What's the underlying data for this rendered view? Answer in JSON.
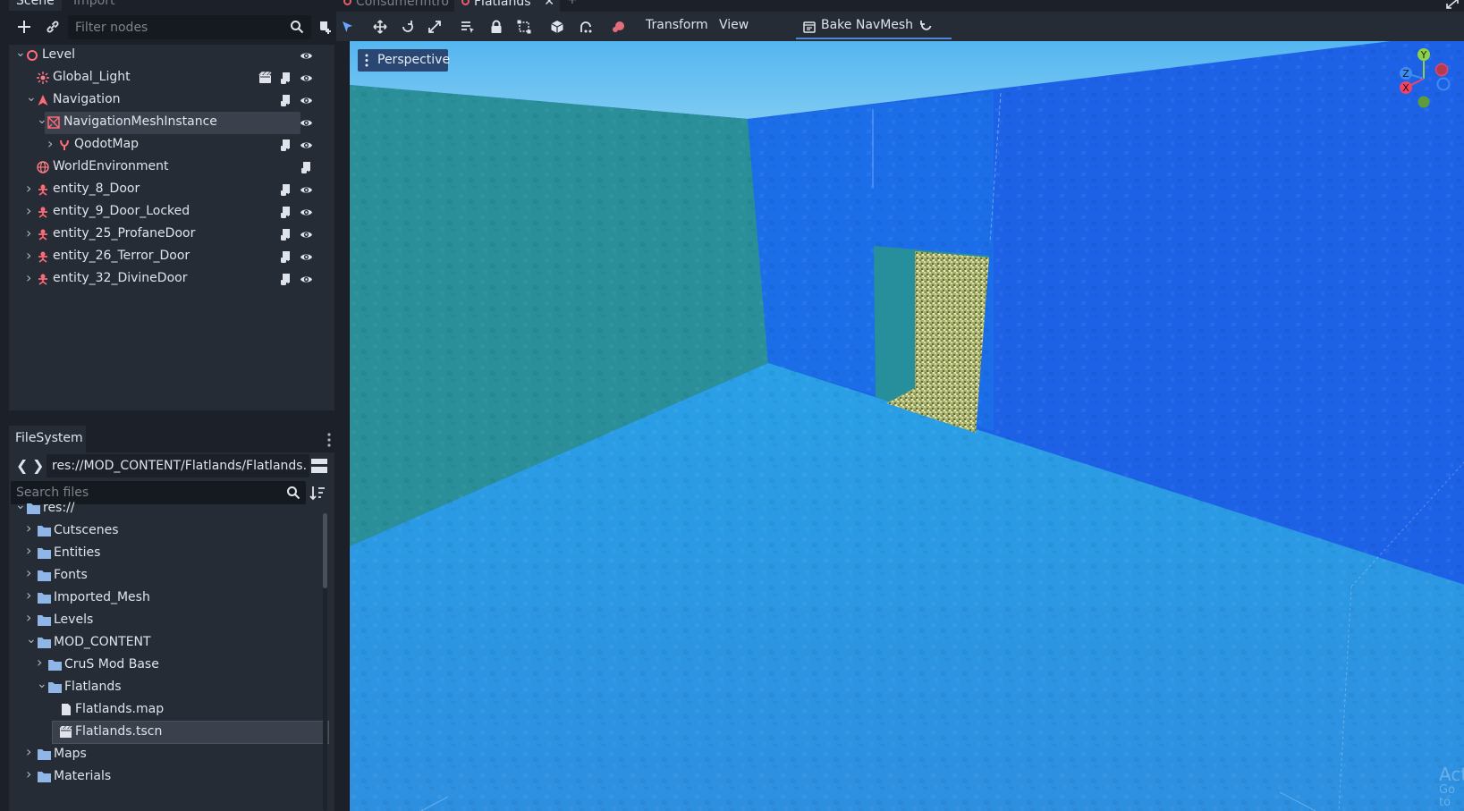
{
  "dock_tabs": {
    "scene": "Scene",
    "import": "Import"
  },
  "scene": {
    "filter_placeholder": "Filter nodes",
    "nodes": [
      {
        "label": "Level",
        "icon": "node3d-icon",
        "depth": 0,
        "expanded": true
      },
      {
        "label": "Global_Light",
        "icon": "light-icon",
        "depth": 1,
        "has_script": true,
        "has_scene": true
      },
      {
        "label": "Navigation",
        "icon": "navigation-icon",
        "depth": 1,
        "expanded": true,
        "has_script": true
      },
      {
        "label": "NavigationMeshInstance",
        "icon": "navmesh-icon",
        "depth": 2,
        "expanded": true,
        "selected": true
      },
      {
        "label": "QodotMap",
        "icon": "qodotmap-icon",
        "depth": 3,
        "has_script": true
      },
      {
        "label": "WorldEnvironment",
        "icon": "world-environment-icon",
        "depth": 1,
        "has_script": true
      },
      {
        "label": "entity_8_Door",
        "icon": "entity-icon",
        "depth": 1,
        "has_script": true
      },
      {
        "label": "entity_9_Door_Locked",
        "icon": "entity-icon",
        "depth": 1,
        "has_script": true
      },
      {
        "label": "entity_25_ProfaneDoor",
        "icon": "entity-icon",
        "depth": 1,
        "has_script": true
      },
      {
        "label": "entity_26_Terror_Door",
        "icon": "entity-icon",
        "depth": 1,
        "has_script": true
      },
      {
        "label": "entity_32_DivineDoor",
        "icon": "entity-icon",
        "depth": 1,
        "has_script": true
      }
    ]
  },
  "filesystem": {
    "tab_label": "FileSystem",
    "path": "res://MOD_CONTENT/Flatlands/Flatlands.",
    "search_placeholder": "Search files",
    "items": [
      {
        "label": "res://",
        "type": "folder",
        "depth": 0,
        "expanded": true
      },
      {
        "label": "Cutscenes",
        "type": "folder",
        "depth": 1
      },
      {
        "label": "Entities",
        "type": "folder",
        "depth": 1
      },
      {
        "label": "Fonts",
        "type": "folder",
        "depth": 1
      },
      {
        "label": "Imported_Mesh",
        "type": "folder",
        "depth": 1
      },
      {
        "label": "Levels",
        "type": "folder",
        "depth": 1
      },
      {
        "label": "MOD_CONTENT",
        "type": "folder",
        "depth": 1,
        "expanded": true
      },
      {
        "label": "CruS Mod Base",
        "type": "folder",
        "depth": 2
      },
      {
        "label": "Flatlands",
        "type": "folder",
        "depth": 2,
        "expanded": true
      },
      {
        "label": "Flatlands.map",
        "type": "file",
        "depth": 3
      },
      {
        "label": "Flatlands.tscn",
        "type": "scene",
        "depth": 3,
        "selected": true
      },
      {
        "label": "Maps",
        "type": "folder",
        "depth": 1
      },
      {
        "label": "Materials",
        "type": "folder",
        "depth": 1
      }
    ]
  },
  "editor_tabs": [
    {
      "label": "ConsumerIntro",
      "active": false
    },
    {
      "label": "Flatlands",
      "active": true
    }
  ],
  "viewport_toolbar": {
    "transform_menu": "Transform",
    "view_menu": "View",
    "bake_navmesh": "Bake NavMesh"
  },
  "viewport": {
    "perspective_label": "Perspective",
    "gizmo": {
      "x": "X",
      "y": "Y",
      "z": "Z"
    },
    "watermark_line1": "Acti",
    "watermark_line2": "Go to"
  },
  "colors": {
    "accent": "#4c86d6",
    "selection": "#3b414c",
    "panel": "#262c36",
    "background": "#1c2028",
    "node_red": "#ff6b78",
    "folder": "#8fb6e6"
  }
}
